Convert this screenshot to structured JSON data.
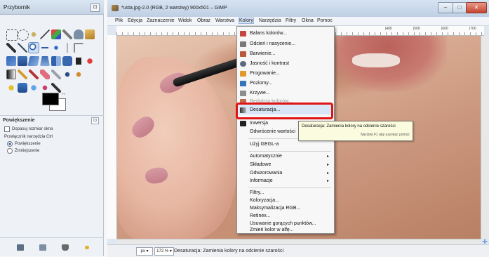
{
  "toolbox": {
    "title": "Przybornik",
    "close_glyph": "⊡",
    "tool_options": {
      "heading": "Powiększenie",
      "resize_window_label": "Dopasuj rozmiar okna",
      "toggle_label": "Przełącznik narzędzia  Ctrl",
      "zoom_in_label": "Powiększenie",
      "zoom_out_label": "Zmniejszenie",
      "reset_glyph": "⊡"
    },
    "swap_glyph": "↔"
  },
  "image_window": {
    "title": "*usta.jpg-2.0 (RGB, 2 warstwy) 900x501 – GIMP",
    "controls": {
      "minimize": "–",
      "maximize": "□",
      "close": "✕"
    },
    "menubar": [
      "Plik",
      "Edycja",
      "Zaznaczenie",
      "Widok",
      "Obraz",
      "Warstwa",
      "Kolory",
      "Narzędzia",
      "Filtry",
      "Okna",
      "Pomoc"
    ],
    "ruler_ticks": [
      "|400",
      "|500",
      "|600",
      "|700"
    ],
    "status": {
      "unit": "px ▾",
      "zoom": "172 % ▾",
      "message": "Desaturacja: Zamienia kolory na odcienie szarości"
    },
    "nav_glyph": "✛"
  },
  "colors_menu": {
    "items": [
      {
        "label": "Balans kolorów...",
        "icon_color": "#c4473d"
      },
      {
        "label": "Odcień i nasycenie...",
        "icon_color": "#7a7a7a"
      },
      {
        "label": "Barwienie...",
        "icon_color": "#b95a3a"
      },
      {
        "label": "Jasność i kontrast",
        "icon_color": "#5b6b7e"
      },
      {
        "label": "Progowanie...",
        "icon_color": "#e0982f"
      },
      {
        "label": "Poziomy...",
        "icon_color": "#3b73b9"
      },
      {
        "label": "Krzywe...",
        "icon_color": "#8d8d8d"
      },
      {
        "label": "Redukcja kolorów...",
        "icon_color": "#c06a4c"
      },
      {
        "label": "Desaturacja...",
        "icon_color": "#555555"
      },
      {
        "label": "Inwersja",
        "icon_color": "#222222"
      },
      {
        "label": "Odwrócenie wartości",
        "icon_color": ""
      },
      {
        "label": "Użyj GEGL-a",
        "icon_color": ""
      },
      {
        "label": "Automatycznie",
        "icon_color": ""
      },
      {
        "label": "Składowe",
        "icon_color": ""
      },
      {
        "label": "Odwzorowania",
        "icon_color": ""
      },
      {
        "label": "Informacje",
        "icon_color": ""
      },
      {
        "label": "Filtry...",
        "icon_color": ""
      },
      {
        "label": "Koloryzacja...",
        "icon_color": ""
      },
      {
        "label": "Maksymalizacja RGB...",
        "icon_color": ""
      },
      {
        "label": "Retinex...",
        "icon_color": ""
      },
      {
        "label": "Usuwanie gorących punktów...",
        "icon_color": ""
      },
      {
        "label": "Zmień kolor w alfę...",
        "icon_color": ""
      }
    ],
    "submenu_arrow": "▸"
  },
  "tooltip": {
    "text": "Desaturacja: Zamienia kolory na odcienie szarości",
    "help": "Naciśnij F1 aby uzyskać pomoc"
  },
  "colors": {
    "highlight": "#e01414",
    "accent": "#2a62b5"
  }
}
